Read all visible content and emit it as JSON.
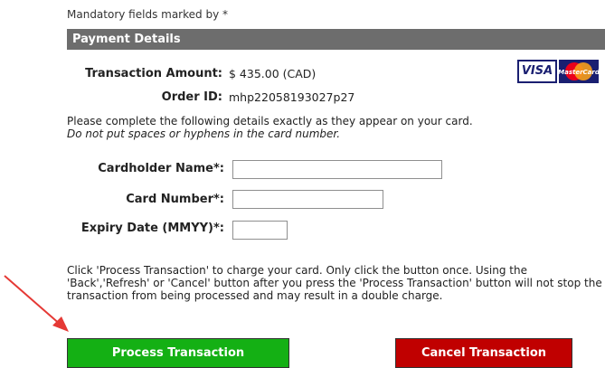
{
  "mandatory_note": "Mandatory fields marked by *",
  "section_title": "Payment Details",
  "summary": {
    "amount_label": "Transaction Amount:",
    "amount_value": "$ 435.00 (CAD)",
    "order_label": "Order ID:",
    "order_value": "mhp22058193027p27"
  },
  "card_logos": {
    "visa_text": "VISA",
    "mastercard_text": "MasterCard"
  },
  "instructions": {
    "line1": "Please complete the following details exactly as they appear on your card.",
    "line2": "Do not put spaces or hyphens in the card number."
  },
  "form": {
    "cardholder_label": "Cardholder Name*:",
    "cardholder_value": "",
    "card_number_label": "Card Number*:",
    "card_number_value": "",
    "expiry_label": "Expiry Date (MMYY)*:",
    "expiry_value": ""
  },
  "notice": {
    "line1": "Click 'Process Transaction' to charge your card. Only click the button once. Using the",
    "line2": "'Back','Refresh' or 'Cancel' button after you press the 'Process Transaction' button will not stop the",
    "line3": "transaction from being processed and may result in a double charge."
  },
  "buttons": {
    "process": "Process Transaction",
    "cancel": "Cancel Transaction"
  },
  "colors": {
    "process_bg": "#14b014",
    "cancel_bg": "#c00000",
    "header_bg": "#6d6d6d",
    "annotation_arrow": "#e53935"
  }
}
